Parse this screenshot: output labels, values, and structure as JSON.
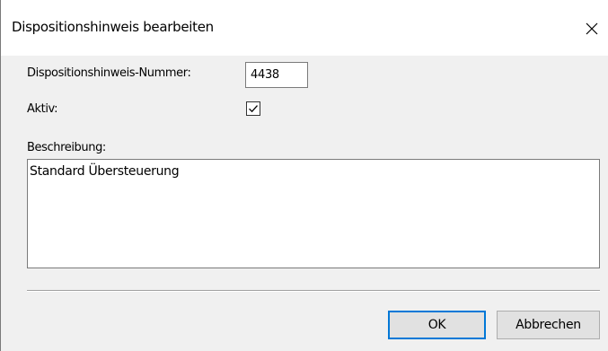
{
  "window": {
    "title": "Dispositionshinweis bearbeiten"
  },
  "form": {
    "nummer_label": "Dispositionshinweis-Nummer:",
    "nummer_value": "4438",
    "aktiv_label": "Aktiv:",
    "aktiv_checked": true,
    "beschreibung_label": "Beschreibung:",
    "beschreibung_value": "Standard Übersteuerung"
  },
  "buttons": {
    "ok_label": "OK",
    "cancel_label": "Abbrechen"
  },
  "colors": {
    "default_button_border": "#0078d7",
    "dialog_background": "#f0f0f0"
  },
  "icons": {
    "close": "close-icon",
    "check": "checkmark-icon"
  }
}
